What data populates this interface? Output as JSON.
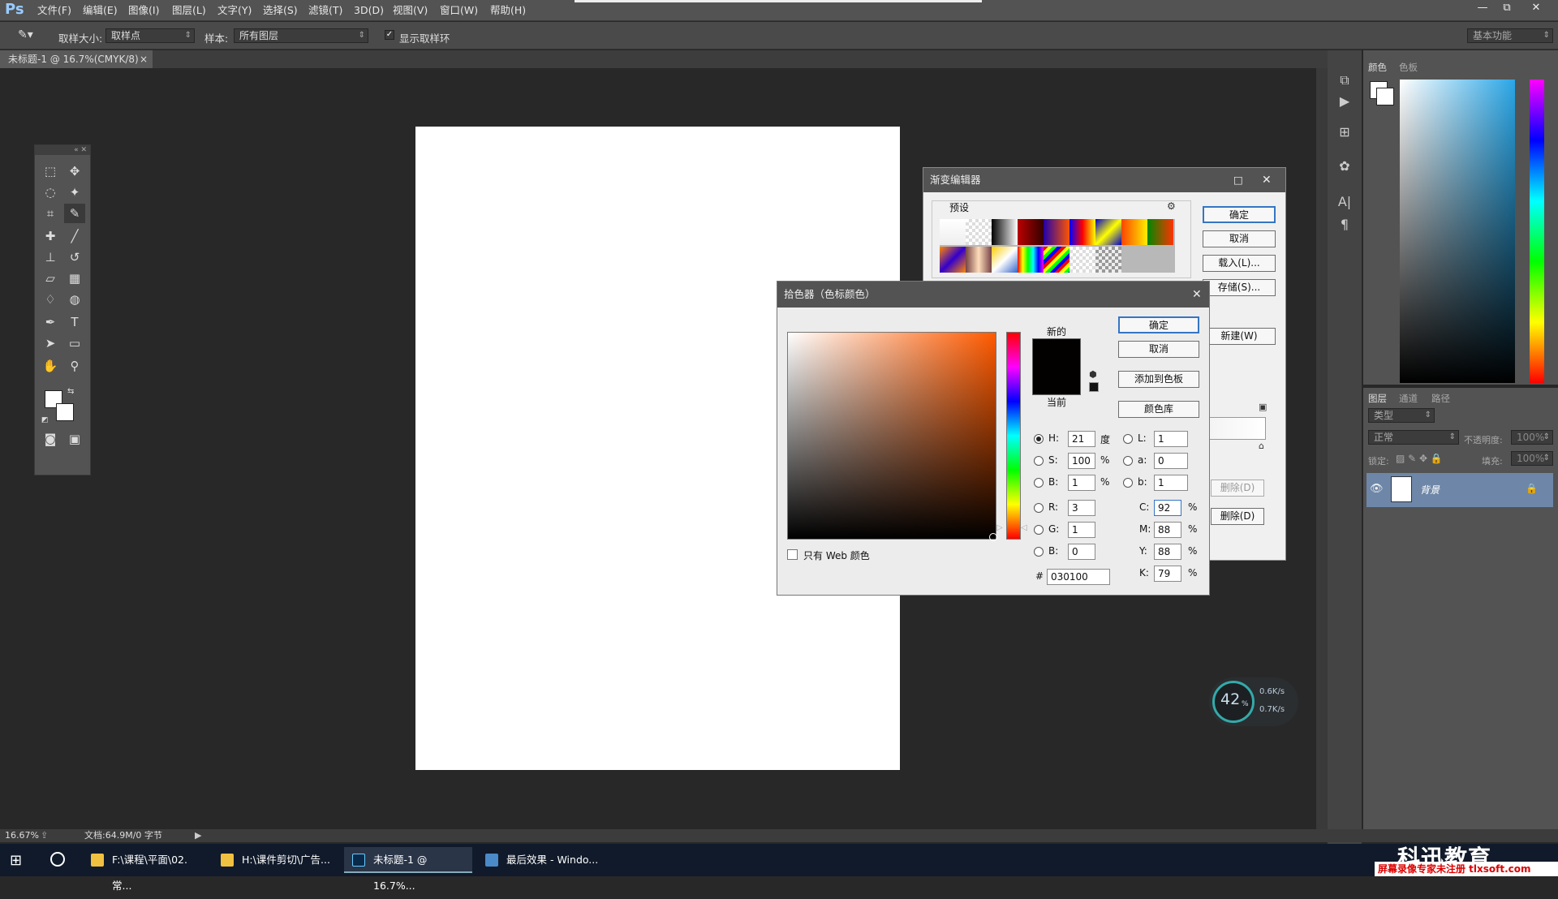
{
  "menubar": {
    "logo": "Ps",
    "items": [
      "文件(F)",
      "编辑(E)",
      "图像(I)",
      "图层(L)",
      "文字(Y)",
      "选择(S)",
      "滤镜(T)",
      "3D(D)",
      "视图(V)",
      "窗口(W)",
      "帮助(H)"
    ],
    "min": "—",
    "restore": "⧉",
    "close": "✕"
  },
  "options": {
    "sample_size_label": "取样大小:",
    "sample_size_value": "取样点",
    "sample_label": "样本:",
    "sample_value": "所有图层",
    "show_ring_label": "显示取样环",
    "workspace": "基本功能"
  },
  "document": {
    "tab_title": "未标题-1 @ 16.7%(CMYK/8)",
    "tab_close": "×",
    "zoom": "16.67%",
    "doc_info": "文档:64.9M/0 字节"
  },
  "color_panel": {
    "tabs": [
      "颜色",
      "色板"
    ]
  },
  "layers_panel": {
    "tabs": [
      "图层",
      "通道",
      "路径"
    ],
    "kind": "类型",
    "blend": "正常",
    "opacity_label": "不透明度:",
    "opacity": "100%",
    "lock_label": "锁定:",
    "fill_label": "填充:",
    "fill": "100%",
    "layer_name": "背景"
  },
  "gradient_editor": {
    "title": "渐变编辑器",
    "preset_label": "预设",
    "ok": "确定",
    "cancel": "取消",
    "load": "载入(L)...",
    "save": "存储(S)...",
    "new": "新建(W)",
    "delete1": "删除(D)",
    "delete2": "删除(D)"
  },
  "picker": {
    "title": "拾色器（色标颜色）",
    "new_label": "新的",
    "current_label": "当前",
    "ok": "确定",
    "cancel": "取消",
    "add_swatch": "添加到色板",
    "libraries": "颜色库",
    "web_only": "只有 Web 颜色",
    "H": "21",
    "H_unit": "度",
    "S": "100",
    "S_unit": "%",
    "B": "1",
    "B_unit": "%",
    "R": "3",
    "G": "1",
    "B2": "0",
    "L": "1",
    "a": "0",
    "b": "1",
    "C": "92",
    "M": "88",
    "Y": "88",
    "K": "79",
    "pct": "%",
    "hex": "030100"
  },
  "taskbar": {
    "items": [
      "F:\\课程\\平面\\02.常...",
      "H:\\课件剪切\\广告...",
      "未标题-1 @ 16.7%...",
      "最后效果 - Windo..."
    ]
  },
  "gauge": {
    "percent": "42",
    "unit": "%",
    "up": "0.6K/s",
    "down": "0.7K/s"
  },
  "watermark": {
    "brand": "科迅教育",
    "note": "屏幕录像专家未注册 tlxsoft.com"
  }
}
